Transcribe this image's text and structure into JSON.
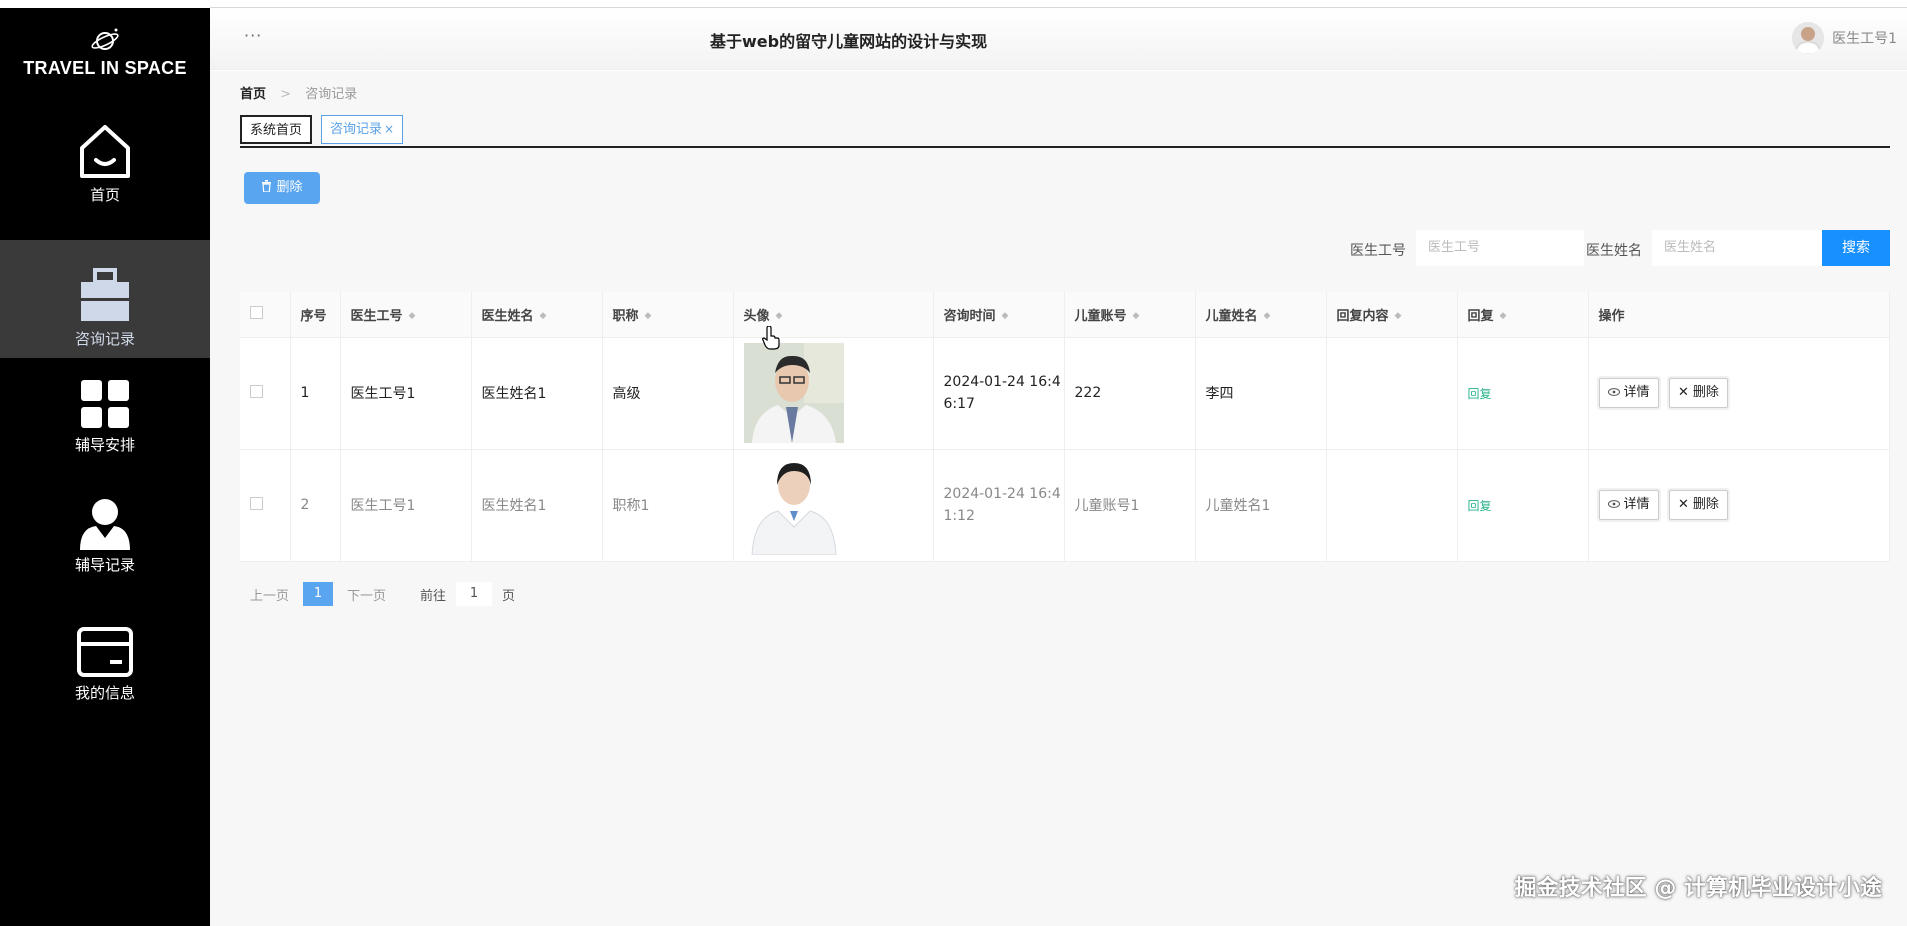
{
  "brand": {
    "title": "TRAVEL IN SPACE",
    "icon": "planet-icon"
  },
  "sidebar": {
    "items": [
      {
        "label": "首页",
        "icon": "home-icon",
        "active": false
      },
      {
        "label": "咨询记录",
        "icon": "briefcase-icon",
        "active": true
      },
      {
        "label": "辅导安排",
        "icon": "grid-icon",
        "active": false
      },
      {
        "label": "辅导记录",
        "icon": "user-icon",
        "active": false
      },
      {
        "label": "我的信息",
        "icon": "card-icon",
        "active": false
      }
    ]
  },
  "header": {
    "menu_dots": "···",
    "site_title": "基于web的留守儿童网站的设计与实现",
    "user_name": "医生工号1"
  },
  "breadcrumb": {
    "home": "首页",
    "separator": ">",
    "current": "咨询记录"
  },
  "tabs": {
    "home": "系统首页",
    "current": "咨询记录",
    "close": "×"
  },
  "toolbar": {
    "delete_label": "删除"
  },
  "search": {
    "doctor_id_label": "医生工号",
    "doctor_id_placeholder": "医生工号",
    "doctor_name_label": "医生姓名",
    "doctor_name_placeholder": "医生姓名",
    "button_label": "搜索"
  },
  "table": {
    "columns": [
      "序号",
      "医生工号",
      "医生姓名",
      "职称",
      "头像",
      "咨询时间",
      "儿童账号",
      "儿童姓名",
      "回复内容",
      "回复",
      "操作"
    ],
    "rows": [
      {
        "index": "1",
        "doctor_id": "医生工号1",
        "doctor_name": "医生姓名1",
        "title": "高级",
        "time_1": "2024-01-24 16:4",
        "time_2": "6:17",
        "child_account": "222",
        "child_name": "李四",
        "reply_content": "",
        "reply": "回复"
      },
      {
        "index": "2",
        "doctor_id": "医生工号1",
        "doctor_name": "医生姓名1",
        "title": "职称1",
        "time_1": "2024-01-24 16:4",
        "time_2": "1:12",
        "child_account": "儿童账号1",
        "child_name": "儿童姓名1",
        "reply_content": "",
        "reply": "回复"
      }
    ],
    "detail_label": "详情",
    "delete_label": "删除"
  },
  "pager": {
    "prev": "上一页",
    "current": "1",
    "next": "下一页",
    "goto": "前往",
    "goto_value": "1",
    "page_unit": "页"
  },
  "watermark": "掘金技术社区 @ 计算机毕业设计小途",
  "colors": {
    "sidebar_bg": "#000000",
    "active_item": "#3a3a3a",
    "primary": "#1890ff",
    "reply_green": "#2bb38c"
  }
}
